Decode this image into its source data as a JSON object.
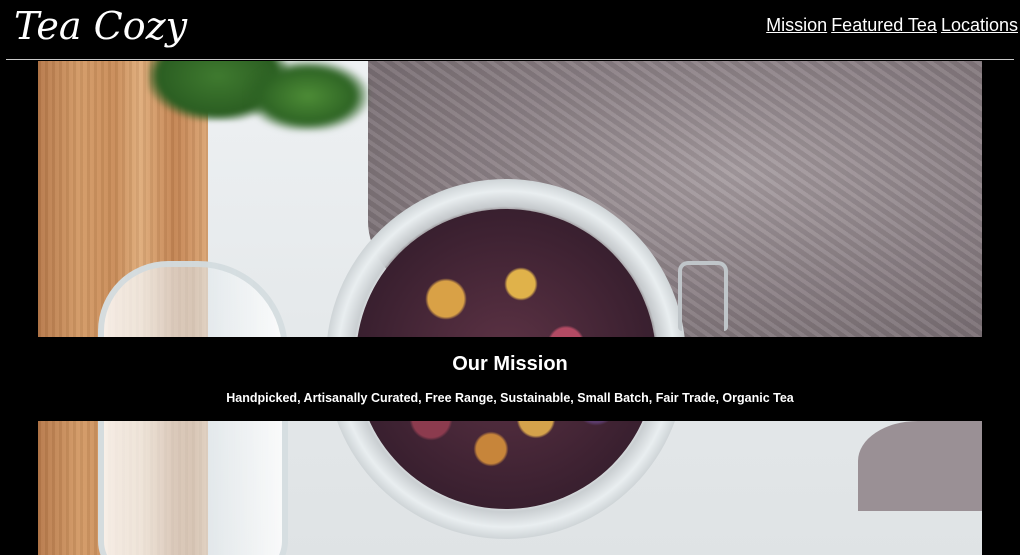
{
  "header": {
    "logo": "Tea Cozy",
    "nav": [
      {
        "label": "Mission"
      },
      {
        "label": "Featured Tea"
      },
      {
        "label": "Locations"
      }
    ]
  },
  "mission": {
    "title": "Our Mission",
    "subtitle": "Handpicked, Artisanally Curated, Free Range, Sustainable, Small Batch, Fair Trade, Organic Tea"
  },
  "colors": {
    "background": "#000000",
    "text": "#ffffff"
  }
}
